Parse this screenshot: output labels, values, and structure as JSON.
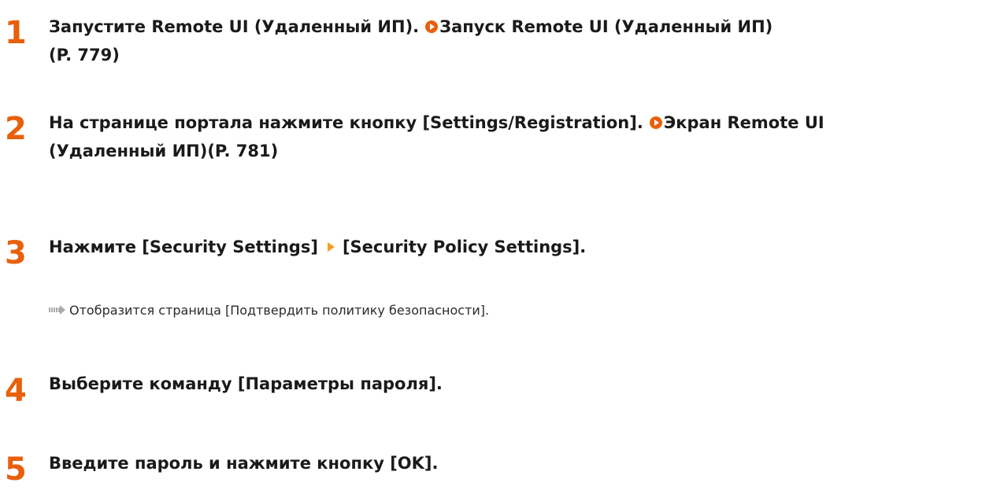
{
  "colors": {
    "accent": "#e8600c",
    "text": "#1a1a1a",
    "separator_arrow": "#f0a020",
    "result_arrow": "#aaaaaa"
  },
  "steps": [
    {
      "number": "1",
      "text": "Запустите Remote UI (Удаленный ИП).",
      "link_line1": "Запуск Remote UI (Удаленный ИП)",
      "link_line2": "(P. 779)"
    },
    {
      "number": "2",
      "text": "На странице портала нажмите кнопку [Settings/Registration].",
      "link_line1": "Экран Remote UI",
      "link_line2": "(Удаленный ИП)(P. 781)"
    },
    {
      "number": "3",
      "part1": "Нажмите [Security Settings]",
      "part2": "[Security Policy Settings].",
      "result": "Отобразится страница [Подтвердить политику безопасности]."
    },
    {
      "number": "4",
      "text": "Выберите команду [Параметры пароля]."
    },
    {
      "number": "5",
      "text": "Введите пароль и нажмите кнопку [OK]."
    }
  ]
}
